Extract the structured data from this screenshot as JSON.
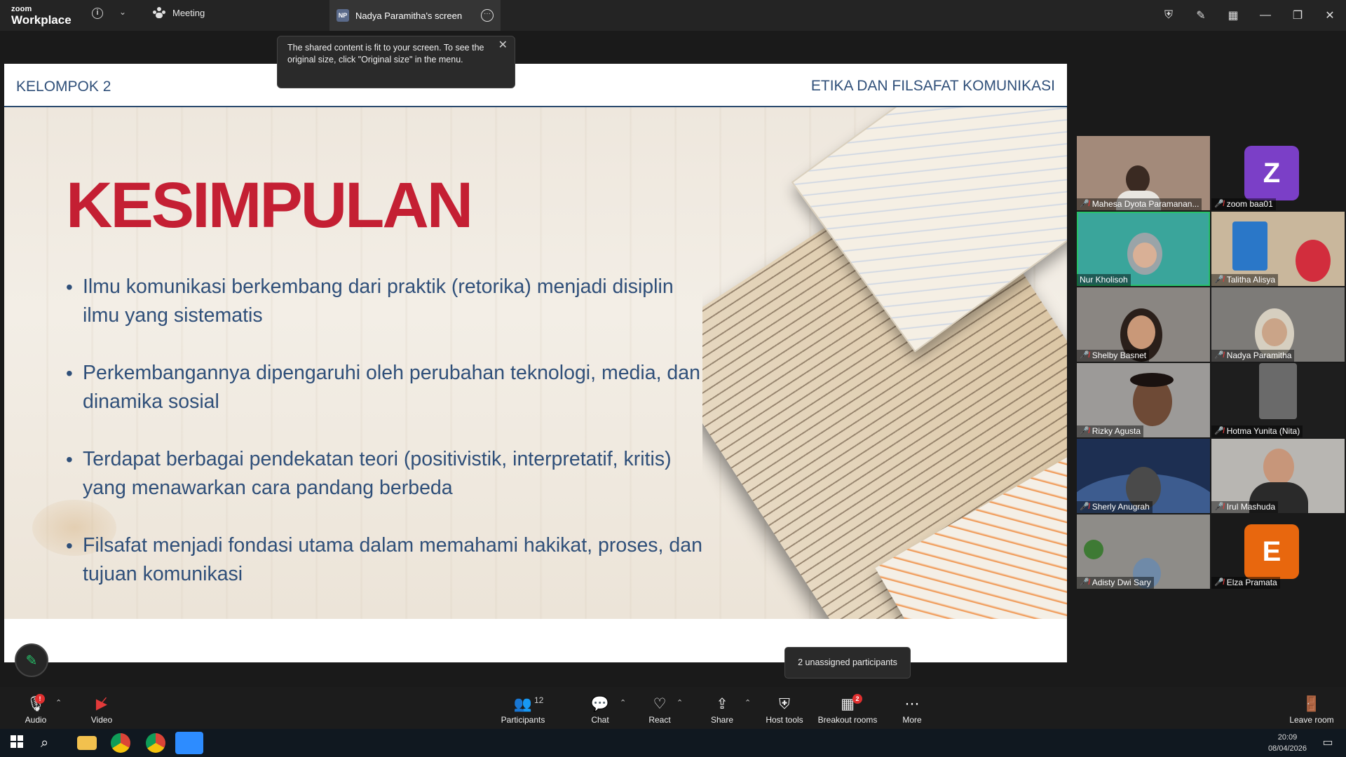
{
  "app": {
    "logo_line1": "zoom",
    "logo_line2": "Workplace",
    "meeting_tab": "Meeting",
    "share_tab": "Nadya Paramitha's screen",
    "share_badge": "NP"
  },
  "tooltip": {
    "text": "The shared content is fit to your screen. To see the original size, click \"Original size\" in the menu."
  },
  "slide": {
    "header_left": "KELOMPOK 2",
    "header_right": "ETIKA DAN FILSAFAT KOMUNIKASI",
    "title": "KESIMPULAN",
    "bullets": [
      "Ilmu komunikasi berkembang dari praktik (retorika) menjadi disiplin ilmu yang sistematis",
      "Perkembangannya dipengaruhi oleh perubahan teknologi, media, dan dinamika sosial",
      "Terdapat berbagai pendekatan teori (positivistik, interpretatif, kritis) yang menawarkan cara pandang berbeda",
      "Filsafat menjadi fondasi utama dalam memahami hakikat, proses, dan tujuan komunikasi"
    ]
  },
  "participants": [
    {
      "name": "Mahesa Dyota Paramanan...",
      "muted": true,
      "bg": "#a38a7a"
    },
    {
      "name": "zoom baa01",
      "muted": true,
      "avatar": "Z",
      "avatar_color": "#7b3fc7"
    },
    {
      "name": "Nur Kholisoh",
      "muted": false,
      "active": true,
      "bg": "#3aa59b"
    },
    {
      "name": "Talitha Alisya",
      "muted": true,
      "bg": "#c9b79c"
    },
    {
      "name": "Shelby Basnet",
      "muted": true,
      "bg": "#8a8682"
    },
    {
      "name": "Nadya Paramitha",
      "muted": true,
      "bg": "#7d7b78"
    },
    {
      "name": "Rizky Agusta",
      "muted": true,
      "bg": "#9c9a98"
    },
    {
      "name": "Hotma Yunita (Nita)",
      "muted": true,
      "bg": "#1e1e1e"
    },
    {
      "name": "Sherly Anugrah",
      "muted": true,
      "bg": "#1d2f52"
    },
    {
      "name": "Irul Mashuda",
      "muted": true,
      "bg": "#b8b6b2"
    },
    {
      "name": "Adisty Dwi Sary",
      "muted": true,
      "bg": "#8e8c88"
    },
    {
      "name": "Elza Pramata",
      "muted": true,
      "avatar": "E",
      "avatar_color": "#e8670e"
    }
  ],
  "toolbar": {
    "audio": "Audio",
    "video": "Video",
    "participants": "Participants",
    "participants_count": "12",
    "chat": "Chat",
    "react": "React",
    "share": "Share",
    "host_tools": "Host tools",
    "breakout_rooms": "Breakout rooms",
    "breakout_badge": "2",
    "more": "More",
    "leave": "Leave room",
    "unassigned": "2 unassigned participants"
  },
  "taskbar": {
    "time": "20:09",
    "date": "08/04/2026"
  },
  "colors": {
    "accent_green": "#27c26a",
    "slide_title_red": "#c41f33",
    "slide_text_blue": "#2f4f79",
    "mute_red": "#e23a3a"
  }
}
